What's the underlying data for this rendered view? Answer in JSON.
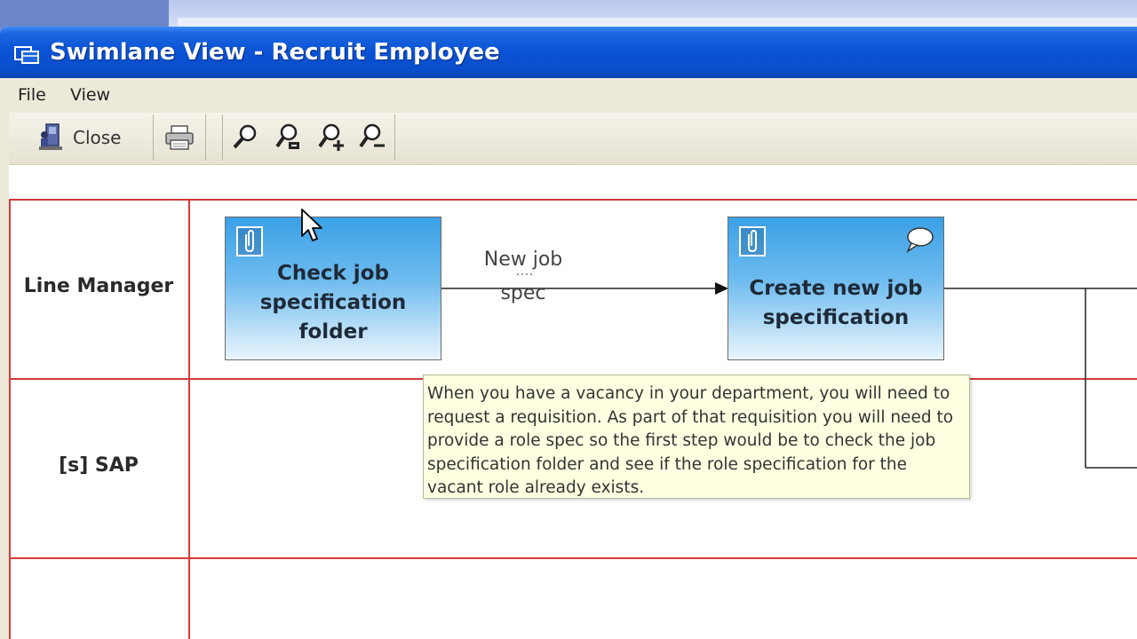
{
  "window": {
    "title": "Swimlane View - Recruit Employee"
  },
  "menu": {
    "items": [
      {
        "label": "File"
      },
      {
        "label": "View"
      }
    ]
  },
  "toolbar": {
    "close_label": "Close",
    "icons": [
      "close-door-icon",
      "printer-icon",
      "zoom-icon",
      "zoom-fit-icon",
      "zoom-in-icon",
      "zoom-out-icon"
    ]
  },
  "lanes": [
    {
      "label": "Line Manager"
    },
    {
      "label": "[s] SAP"
    }
  ],
  "tasks": [
    {
      "label_lines": [
        "Check job",
        "specification",
        "folder"
      ]
    },
    {
      "label_lines": [
        "Create new job",
        "specification"
      ]
    }
  ],
  "flow": {
    "label_lines": [
      "New job",
      "spec"
    ]
  },
  "tooltip": {
    "text": "When you have a vacancy in your department, you will need to request a requisition. As part of that requisition you will need to provide a role spec so the first step would be to check the job specification folder and see if the role specification for the vacant role already exists."
  },
  "colors": {
    "lane_line": "#d63a3a",
    "task_fill": "#6fbcef",
    "tooltip_bg": "#ffffe1"
  }
}
